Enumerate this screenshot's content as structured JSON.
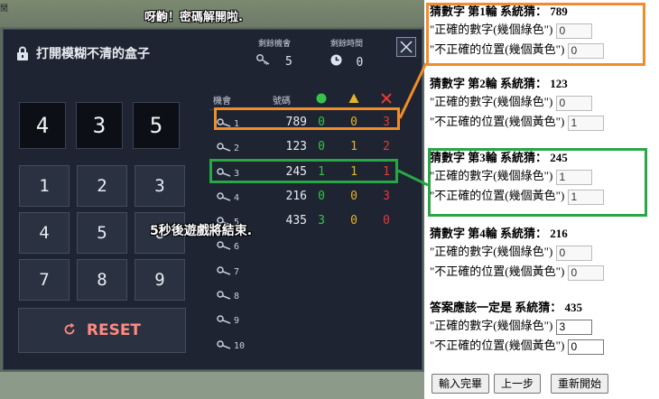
{
  "game": {
    "banner": "呀齣！密碼解開啦.",
    "edge_char": "閒",
    "title": "打開模糊不清的盒子",
    "stats": {
      "remaining_chances_label": "剩餘機會",
      "remaining_chances_value": "5",
      "remaining_time_label": "剩餘時間",
      "remaining_time_value": "0"
    },
    "current_digits": [
      "4",
      "3",
      "5"
    ],
    "keypad": [
      "1",
      "2",
      "3",
      "4",
      "5",
      "6",
      "7",
      "8",
      "9"
    ],
    "reset_label": "RESET",
    "countdown": "5秒後遊戲將結束.",
    "table_headers": {
      "chance": "機會",
      "number": "號碼",
      "green_icon": "green-circle",
      "yellow_icon": "yellow-triangle",
      "red_icon": "red-x"
    },
    "rows": [
      {
        "idx": "1",
        "num": "789",
        "g": "0",
        "y": "0",
        "r": "3"
      },
      {
        "idx": "2",
        "num": "123",
        "g": "0",
        "y": "1",
        "r": "2"
      },
      {
        "idx": "3",
        "num": "245",
        "g": "1",
        "y": "1",
        "r": "1"
      },
      {
        "idx": "4",
        "num": "216",
        "g": "0",
        "y": "0",
        "r": "3"
      },
      {
        "idx": "5",
        "num": "435",
        "g": "3",
        "y": "0",
        "r": "0"
      },
      {
        "idx": "6",
        "num": "",
        "g": "",
        "y": "",
        "r": ""
      },
      {
        "idx": "7",
        "num": "",
        "g": "",
        "y": "",
        "r": ""
      },
      {
        "idx": "8",
        "num": "",
        "g": "",
        "y": "",
        "r": ""
      },
      {
        "idx": "9",
        "num": "",
        "g": "",
        "y": "",
        "r": ""
      },
      {
        "idx": "10",
        "num": "",
        "g": "",
        "y": "",
        "r": ""
      }
    ],
    "colors": {
      "green": "#35c34a",
      "yellow": "#e6b422",
      "red": "#e53935",
      "highlight_orange": "#f28c28",
      "highlight_green": "#28a745"
    }
  },
  "solver": {
    "green_label": "\"正確的數字(幾個綠色\")",
    "yellow_label": "\"不正確的位置(幾個黃色\")",
    "rounds": [
      {
        "title": "猜數字 第1輪 系統猜：",
        "guess": "789",
        "green": "0",
        "yellow": "0"
      },
      {
        "title": "猜數字 第2輪 系統猜：",
        "guess": "123",
        "green": "0",
        "yellow": "1"
      },
      {
        "title": "猜數字 第3輪 系統猜：",
        "guess": "245",
        "green": "1",
        "yellow": "1"
      },
      {
        "title": "猜數字 第4輪 系統猜：",
        "guess": "216",
        "green": "0",
        "yellow": "0"
      },
      {
        "title": "答案應該一定是 系統猜：",
        "guess": "435",
        "green": "3",
        "yellow": "0"
      }
    ],
    "buttons": {
      "submit": "輸入完畢",
      "back": "上一步",
      "restart": "重新開始"
    }
  }
}
